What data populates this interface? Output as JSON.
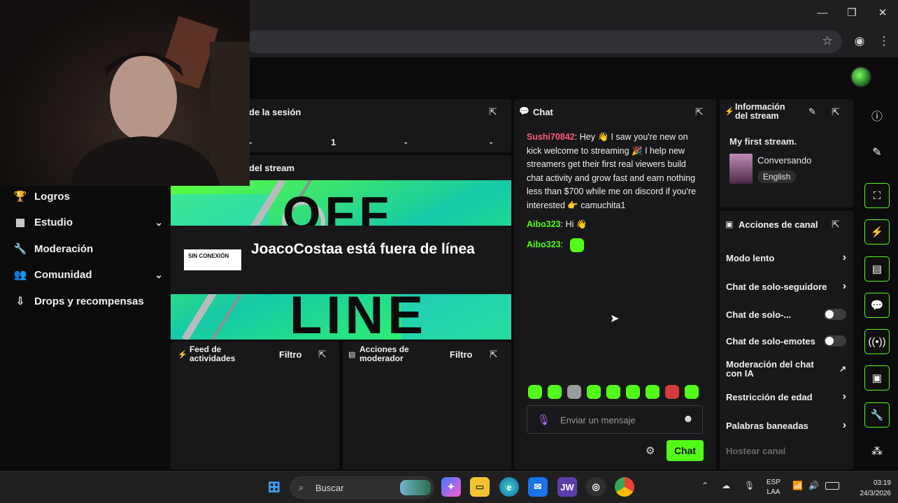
{
  "browser": {
    "window_controls": {
      "minimize": "—",
      "maximize": "❐",
      "close": "✕"
    }
  },
  "sidebar": {
    "items": [
      {
        "label": "Logros",
        "icon": "trophy-icon"
      },
      {
        "label": "Estudio",
        "icon": "studio-icon",
        "expandable": true
      },
      {
        "label": "Moderación",
        "icon": "wrench-icon"
      },
      {
        "label": "Comunidad",
        "icon": "community-icon",
        "expandable": true
      },
      {
        "label": "Drops y recompensas",
        "icon": "drops-icon"
      }
    ]
  },
  "session_panel": {
    "title": "de la sesión",
    "stats": [
      "-",
      "1",
      "-",
      "-"
    ]
  },
  "stream_panel": {
    "title": "del stream",
    "offline_badge": "SIN CONEXIÓN",
    "offline_text": "JoacoCostaa está fuera de línea",
    "bg_text_top": "OFF",
    "bg_text_bottom": "LINE"
  },
  "activity_feed": {
    "title": "Feed de actividades",
    "filter": "Filtro"
  },
  "mod_actions": {
    "title": "Acciones de moderador",
    "filter": "Filtro"
  },
  "chat": {
    "title": "Chat",
    "messages": [
      {
        "user": "Sushi70842",
        "text": "Hey 👋 I saw you're new on kick welcome to streaming 🎉 I help new streamers get their first real viewers build chat activity and grow fast and earn nothing less than $700 while me on discord if you're interested 👉 camuchita1"
      },
      {
        "user": "Aibo323",
        "text": "Hi 👋"
      },
      {
        "user": "Aibo323",
        "text": ""
      }
    ],
    "input_placeholder": "Enviar un mensaje",
    "send_label": "Chat"
  },
  "stream_info": {
    "title": "Información del stream",
    "stream_title": "My first stream.",
    "category": "Conversando",
    "language": "English"
  },
  "channel_actions": {
    "title": "Acciones de canal",
    "items": [
      {
        "label": "Modo lento",
        "control": "chevron"
      },
      {
        "label": "Chat de solo-seguidore",
        "control": "chevron"
      },
      {
        "label": "Chat de solo-...",
        "control": "toggle",
        "on": false
      },
      {
        "label": "Chat de solo-emotes",
        "control": "toggle",
        "on": false
      },
      {
        "label": "Moderación del chat con IA",
        "control": "external"
      },
      {
        "label": "Restricción de edad",
        "control": "chevron"
      },
      {
        "label": "Palabras baneadas",
        "control": "chevron"
      },
      {
        "label": "Hostear canal",
        "control": "none",
        "disabled": true
      }
    ]
  },
  "taskbar": {
    "search_label": "Buscar",
    "apps": [
      "windows-start",
      "copilot",
      "file-explorer",
      "edge",
      "outlook",
      "jw",
      "obs",
      "chrome"
    ],
    "jw_label": "JW",
    "language": "ESP",
    "layout": "LAA",
    "time": "03:19",
    "date": "24/3/2026"
  },
  "colors": {
    "accent": "#53fc18",
    "panel": "#18181a",
    "background": "#0b0b0c",
    "username_red": "#ff5d7a"
  }
}
